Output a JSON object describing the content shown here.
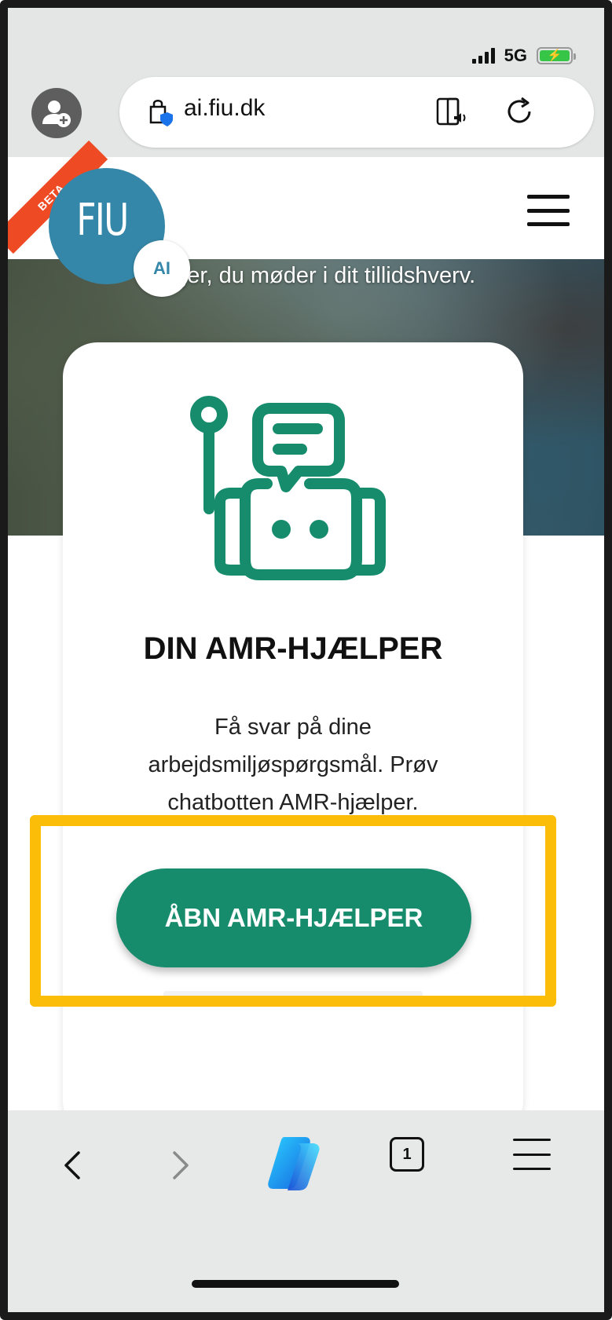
{
  "status_bar": {
    "network": "5G"
  },
  "browser": {
    "url": "ai.fiu.dk"
  },
  "site": {
    "beta_label": "BETA",
    "logo_text": "FIU",
    "logo_badge": "AI",
    "hero_text": "dringer, du møder i dit tillidshverv."
  },
  "card": {
    "icon": "chatbot-robot-icon",
    "title": "DIN AMR-HJÆLPER",
    "description": "Få svar på dine arbejdsmiljøspørgsmål. Prøv chatbotten AMR-hjælper.",
    "button_label": "ÅBN AMR-HJÆLPER"
  },
  "toolbar": {
    "tab_count": "1"
  },
  "colors": {
    "brand_green": "#168c6d",
    "logo_blue": "#3587a9",
    "beta_orange": "#ee4a23",
    "highlight_yellow": "#fbbd08"
  }
}
